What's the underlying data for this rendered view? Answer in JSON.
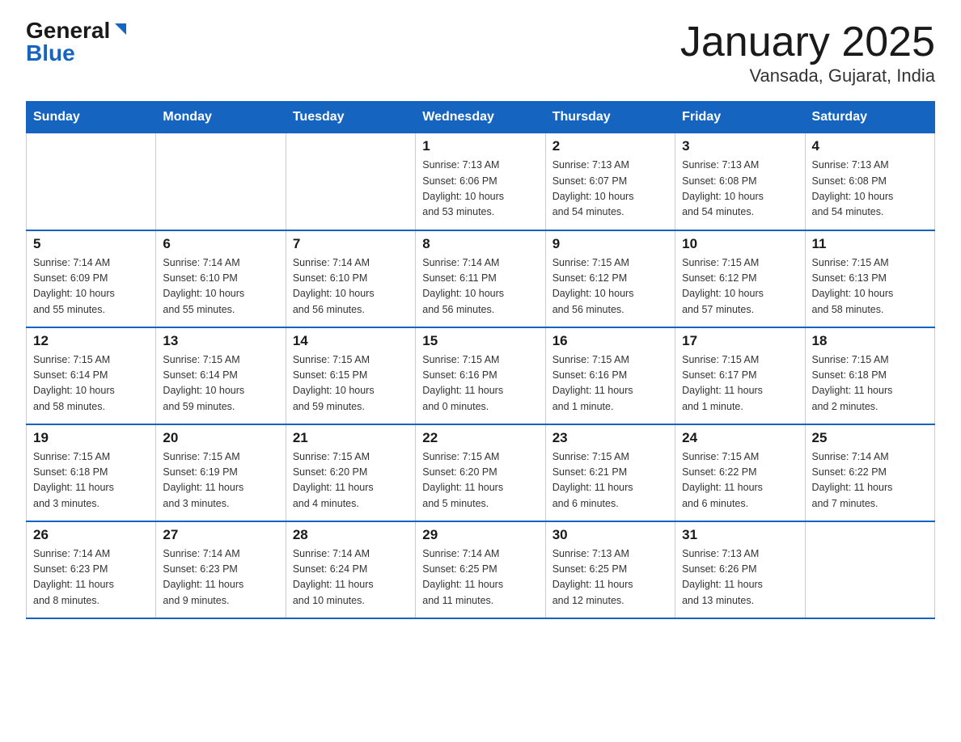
{
  "header": {
    "logo_general": "General",
    "logo_blue": "Blue",
    "title": "January 2025",
    "subtitle": "Vansada, Gujarat, India"
  },
  "days_of_week": [
    "Sunday",
    "Monday",
    "Tuesday",
    "Wednesday",
    "Thursday",
    "Friday",
    "Saturday"
  ],
  "weeks": [
    [
      {
        "day": "",
        "info": ""
      },
      {
        "day": "",
        "info": ""
      },
      {
        "day": "",
        "info": ""
      },
      {
        "day": "1",
        "info": "Sunrise: 7:13 AM\nSunset: 6:06 PM\nDaylight: 10 hours\nand 53 minutes."
      },
      {
        "day": "2",
        "info": "Sunrise: 7:13 AM\nSunset: 6:07 PM\nDaylight: 10 hours\nand 54 minutes."
      },
      {
        "day": "3",
        "info": "Sunrise: 7:13 AM\nSunset: 6:08 PM\nDaylight: 10 hours\nand 54 minutes."
      },
      {
        "day": "4",
        "info": "Sunrise: 7:13 AM\nSunset: 6:08 PM\nDaylight: 10 hours\nand 54 minutes."
      }
    ],
    [
      {
        "day": "5",
        "info": "Sunrise: 7:14 AM\nSunset: 6:09 PM\nDaylight: 10 hours\nand 55 minutes."
      },
      {
        "day": "6",
        "info": "Sunrise: 7:14 AM\nSunset: 6:10 PM\nDaylight: 10 hours\nand 55 minutes."
      },
      {
        "day": "7",
        "info": "Sunrise: 7:14 AM\nSunset: 6:10 PM\nDaylight: 10 hours\nand 56 minutes."
      },
      {
        "day": "8",
        "info": "Sunrise: 7:14 AM\nSunset: 6:11 PM\nDaylight: 10 hours\nand 56 minutes."
      },
      {
        "day": "9",
        "info": "Sunrise: 7:15 AM\nSunset: 6:12 PM\nDaylight: 10 hours\nand 56 minutes."
      },
      {
        "day": "10",
        "info": "Sunrise: 7:15 AM\nSunset: 6:12 PM\nDaylight: 10 hours\nand 57 minutes."
      },
      {
        "day": "11",
        "info": "Sunrise: 7:15 AM\nSunset: 6:13 PM\nDaylight: 10 hours\nand 58 minutes."
      }
    ],
    [
      {
        "day": "12",
        "info": "Sunrise: 7:15 AM\nSunset: 6:14 PM\nDaylight: 10 hours\nand 58 minutes."
      },
      {
        "day": "13",
        "info": "Sunrise: 7:15 AM\nSunset: 6:14 PM\nDaylight: 10 hours\nand 59 minutes."
      },
      {
        "day": "14",
        "info": "Sunrise: 7:15 AM\nSunset: 6:15 PM\nDaylight: 10 hours\nand 59 minutes."
      },
      {
        "day": "15",
        "info": "Sunrise: 7:15 AM\nSunset: 6:16 PM\nDaylight: 11 hours\nand 0 minutes."
      },
      {
        "day": "16",
        "info": "Sunrise: 7:15 AM\nSunset: 6:16 PM\nDaylight: 11 hours\nand 1 minute."
      },
      {
        "day": "17",
        "info": "Sunrise: 7:15 AM\nSunset: 6:17 PM\nDaylight: 11 hours\nand 1 minute."
      },
      {
        "day": "18",
        "info": "Sunrise: 7:15 AM\nSunset: 6:18 PM\nDaylight: 11 hours\nand 2 minutes."
      }
    ],
    [
      {
        "day": "19",
        "info": "Sunrise: 7:15 AM\nSunset: 6:18 PM\nDaylight: 11 hours\nand 3 minutes."
      },
      {
        "day": "20",
        "info": "Sunrise: 7:15 AM\nSunset: 6:19 PM\nDaylight: 11 hours\nand 3 minutes."
      },
      {
        "day": "21",
        "info": "Sunrise: 7:15 AM\nSunset: 6:20 PM\nDaylight: 11 hours\nand 4 minutes."
      },
      {
        "day": "22",
        "info": "Sunrise: 7:15 AM\nSunset: 6:20 PM\nDaylight: 11 hours\nand 5 minutes."
      },
      {
        "day": "23",
        "info": "Sunrise: 7:15 AM\nSunset: 6:21 PM\nDaylight: 11 hours\nand 6 minutes."
      },
      {
        "day": "24",
        "info": "Sunrise: 7:15 AM\nSunset: 6:22 PM\nDaylight: 11 hours\nand 6 minutes."
      },
      {
        "day": "25",
        "info": "Sunrise: 7:14 AM\nSunset: 6:22 PM\nDaylight: 11 hours\nand 7 minutes."
      }
    ],
    [
      {
        "day": "26",
        "info": "Sunrise: 7:14 AM\nSunset: 6:23 PM\nDaylight: 11 hours\nand 8 minutes."
      },
      {
        "day": "27",
        "info": "Sunrise: 7:14 AM\nSunset: 6:23 PM\nDaylight: 11 hours\nand 9 minutes."
      },
      {
        "day": "28",
        "info": "Sunrise: 7:14 AM\nSunset: 6:24 PM\nDaylight: 11 hours\nand 10 minutes."
      },
      {
        "day": "29",
        "info": "Sunrise: 7:14 AM\nSunset: 6:25 PM\nDaylight: 11 hours\nand 11 minutes."
      },
      {
        "day": "30",
        "info": "Sunrise: 7:13 AM\nSunset: 6:25 PM\nDaylight: 11 hours\nand 12 minutes."
      },
      {
        "day": "31",
        "info": "Sunrise: 7:13 AM\nSunset: 6:26 PM\nDaylight: 11 hours\nand 13 minutes."
      },
      {
        "day": "",
        "info": ""
      }
    ]
  ]
}
